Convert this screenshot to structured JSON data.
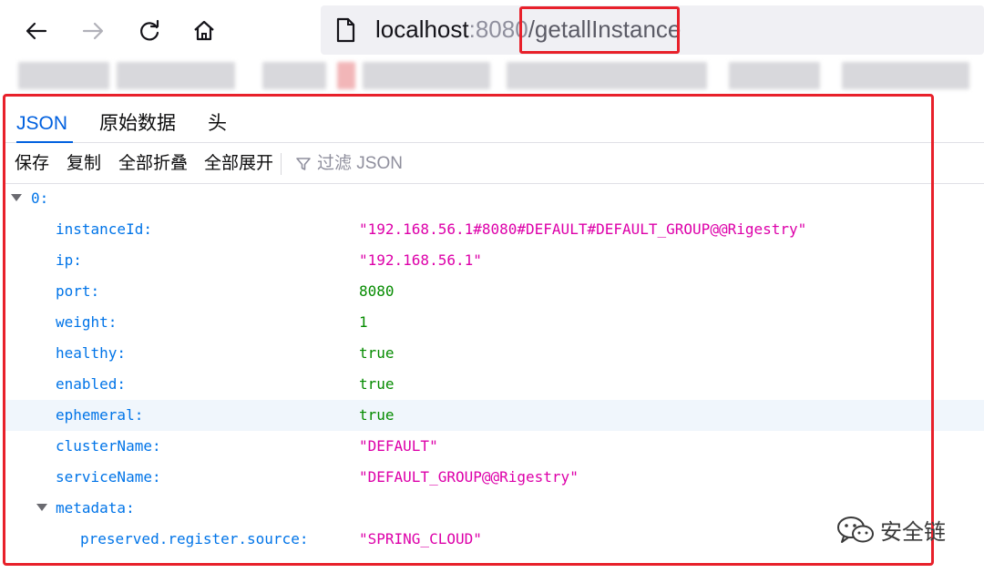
{
  "browser": {
    "url": {
      "host": "localhost",
      "port": ":8080",
      "path": "/getallInstance"
    }
  },
  "viewer": {
    "tabs": [
      {
        "label": "JSON",
        "active": true
      },
      {
        "label": "原始数据",
        "active": false
      },
      {
        "label": "头",
        "active": false
      }
    ],
    "toolbar": {
      "save_label": "保存",
      "copy_label": "复制",
      "collapse_all_label": "全部折叠",
      "expand_all_label": "全部展开",
      "filter_placeholder": "过滤 JSON"
    },
    "tree": {
      "root_key": "0:",
      "fields": [
        {
          "key": "instanceId:",
          "value": "\"192.168.56.1#8080#DEFAULT#DEFAULT_GROUP@@Rigestry\"",
          "type": "string"
        },
        {
          "key": "ip:",
          "value": "\"192.168.56.1\"",
          "type": "string"
        },
        {
          "key": "port:",
          "value": "8080",
          "type": "number"
        },
        {
          "key": "weight:",
          "value": "1",
          "type": "number"
        },
        {
          "key": "healthy:",
          "value": "true",
          "type": "boolean"
        },
        {
          "key": "enabled:",
          "value": "true",
          "type": "boolean"
        },
        {
          "key": "ephemeral:",
          "value": "true",
          "type": "boolean"
        },
        {
          "key": "clusterName:",
          "value": "\"DEFAULT\"",
          "type": "string"
        },
        {
          "key": "serviceName:",
          "value": "\"DEFAULT_GROUP@@Rigestry\"",
          "type": "string"
        }
      ],
      "metadata_key": "metadata:",
      "metadata_fields": [
        {
          "key": "preserved.register.source:",
          "value": "\"SPRING_CLOUD\"",
          "type": "string"
        }
      ]
    }
  },
  "watermark": {
    "text": "安全链"
  },
  "colors": {
    "accent": "#0060df",
    "highlight": "#e8202a",
    "key": "#0074e8",
    "string": "#dd00a9",
    "number": "#058b00"
  }
}
